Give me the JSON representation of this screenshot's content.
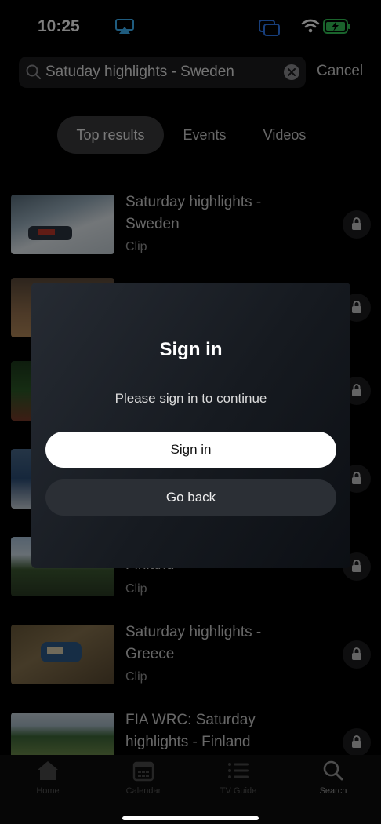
{
  "status_bar": {
    "time": "10:25",
    "airplay_icon": "airplay-icon",
    "screen_mirror_icon": "screen-mirroring-icon",
    "wifi_icon": "wifi-icon",
    "battery_icon": "battery-charging-icon",
    "accent_airplay": "#3fb8ff",
    "accent_mirror": "#2f7cf6",
    "battery_color": "#34c759"
  },
  "search": {
    "query": "Satuday highlights - Sweden",
    "cancel_label": "Cancel"
  },
  "tabs": [
    {
      "label": "Top results",
      "active": true
    },
    {
      "label": "Events",
      "active": false
    },
    {
      "label": "Videos",
      "active": false
    }
  ],
  "results": [
    {
      "title": "Saturday highlights - Sweden",
      "kind": "Clip",
      "locked": true
    },
    {
      "title": "",
      "kind": "",
      "locked": true
    },
    {
      "title": "",
      "kind": "",
      "locked": true
    },
    {
      "title": "",
      "kind": "",
      "locked": true
    },
    {
      "title": "Finland",
      "kind": "Clip",
      "locked": true
    },
    {
      "title": "Saturday highlights - Greece",
      "kind": "Clip",
      "locked": true
    },
    {
      "title": "FIA WRC: Saturday highlights - Finland",
      "kind": "",
      "locked": true
    }
  ],
  "modal": {
    "title": "Sign in",
    "message": "Please sign in to continue",
    "primary_label": "Sign in",
    "secondary_label": "Go back"
  },
  "tab_bar": [
    {
      "label": "Home",
      "icon": "home-icon",
      "active": false
    },
    {
      "label": "Calendar",
      "icon": "calendar-icon",
      "active": false
    },
    {
      "label": "TV Guide",
      "icon": "list-icon",
      "active": false
    },
    {
      "label": "Search",
      "icon": "search-icon",
      "active": true
    }
  ]
}
